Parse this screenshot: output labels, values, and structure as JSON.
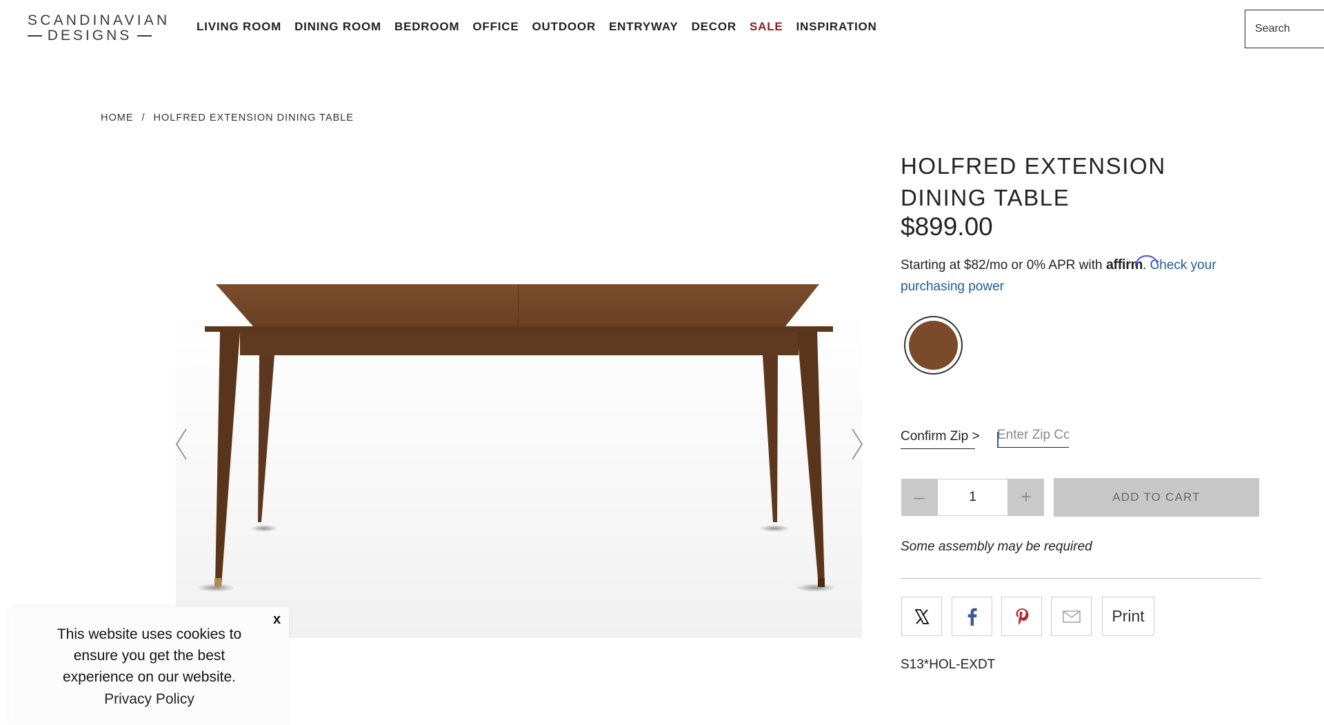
{
  "header": {
    "logo": {
      "line1": "SCANDINAVIAN",
      "line2": "DESIGNS"
    },
    "nav": [
      "LIVING ROOM",
      "DINING ROOM",
      "BEDROOM",
      "OFFICE",
      "OUTDOOR",
      "ENTRYWAY",
      "DECOR",
      "SALE",
      "INSPIRATION"
    ],
    "search_placeholder": "Search"
  },
  "breadcrumb": {
    "home": "HOME",
    "separator": "/",
    "current": "HOLFRED EXTENSION DINING TABLE"
  },
  "product": {
    "title": "HOLFRED EXTENSION DINING TABLE",
    "price": "$899.00",
    "affirm": {
      "prefix": "Starting at $82/mo or 0% APR with ",
      "brand": "affirm",
      "dot": ". ",
      "link": "Check your purchasing power"
    },
    "swatch_color": "#7a4a2a",
    "zip": {
      "label": "Confirm Zip >",
      "placeholder": "Enter Zip Code"
    },
    "quantity": {
      "minus": "–",
      "value": "1",
      "plus": "+"
    },
    "add_to_cart": "ADD TO CART",
    "assembly_note": "Some assembly may be required",
    "share": {
      "print": "Print"
    },
    "sku": "S13*HOL-EXDT"
  },
  "cookie_banner": {
    "message": "This website uses cookies to ensure you get the best experience on our website.",
    "policy_link": "Privacy Policy",
    "close": "x"
  },
  "colors": {
    "sale": "#8b1d1d",
    "link": "#1f5a9b",
    "button_disabled": "#c7c7c7",
    "wood": "#7a4a2a"
  }
}
